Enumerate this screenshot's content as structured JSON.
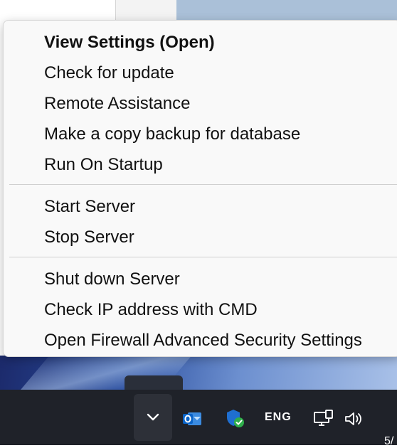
{
  "menu": {
    "items": [
      {
        "label": "View Settings (Open)",
        "bold": true
      },
      {
        "label": "Check for update"
      },
      {
        "label": "Remote Assistance"
      },
      {
        "label": "Make a copy backup for database"
      },
      {
        "label": "Run On Startup"
      },
      {
        "label": "Start Server"
      },
      {
        "label": "Stop Server"
      },
      {
        "label": "Shut down Server"
      },
      {
        "label": "Check IP address with CMD"
      },
      {
        "label": "Open Firewall Advanced Security Settings"
      }
    ]
  },
  "taskbar": {
    "language": "ENG",
    "clock_fragment": "5/",
    "icons": [
      "chevron-up-icon",
      "outlook-icon",
      "security-shield-icon",
      "network-icon",
      "volume-icon"
    ]
  },
  "colors": {
    "menu_bg": "#f9f9f9",
    "taskbar_bg": "#1f2229",
    "outlook_blue": "#0a64c8",
    "shield_blue": "#1f6fd1",
    "check_green": "#2faf4b"
  }
}
